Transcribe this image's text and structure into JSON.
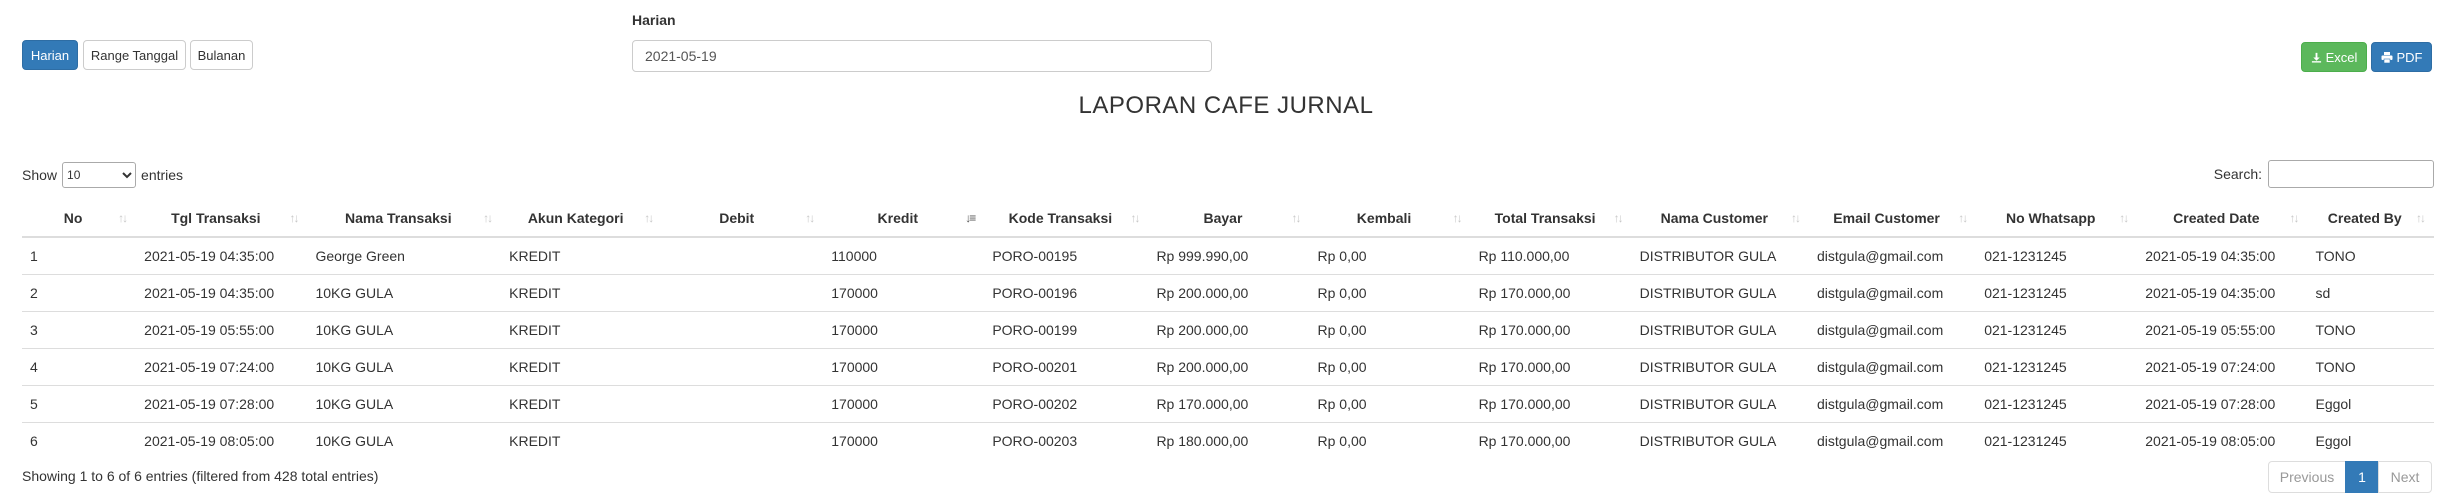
{
  "toolbar": {
    "harian_label": "Harian",
    "range_label": "Range Tanggal",
    "bulanan_label": "Bulanan",
    "excel_label": "Excel",
    "pdf_label": "PDF",
    "accent_color": "#337ab7",
    "excel_color": "#5cb85c"
  },
  "filter": {
    "label": "Harian",
    "date_value": "2021-05-19"
  },
  "report": {
    "title": "LAPORAN CAFE JURNAL"
  },
  "length": {
    "show_label": "Show",
    "selected": "10",
    "entries_label": "entries"
  },
  "search": {
    "label": "Search:",
    "value": ""
  },
  "table": {
    "columns": [
      "No",
      "Tgl Transaksi",
      "Nama Transaksi",
      "Akun Kategori",
      "Debit",
      "Kredit",
      "Kode Transaksi",
      "Bayar",
      "Kembali",
      "Total Transaksi",
      "Nama Customer",
      "Email Customer",
      "No Whatsapp",
      "Created Date",
      "Created By"
    ],
    "sorted_column": "Kredit",
    "rows": [
      [
        "1",
        "2021-05-19 04:35:00",
        "George Green",
        "KREDIT",
        "",
        "110000",
        "PORO-00195",
        "Rp 999.990,00",
        "Rp 0,00",
        "Rp 110.000,00",
        "DISTRIBUTOR GULA",
        "distgula@gmail.com",
        "021-1231245",
        "2021-05-19 04:35:00",
        "TONO"
      ],
      [
        "2",
        "2021-05-19 04:35:00",
        "10KG GULA",
        "KREDIT",
        "",
        "170000",
        "PORO-00196",
        "Rp 200.000,00",
        "Rp 0,00",
        "Rp 170.000,00",
        "DISTRIBUTOR GULA",
        "distgula@gmail.com",
        "021-1231245",
        "2021-05-19 04:35:00",
        "sd"
      ],
      [
        "3",
        "2021-05-19 05:55:00",
        "10KG GULA",
        "KREDIT",
        "",
        "170000",
        "PORO-00199",
        "Rp 200.000,00",
        "Rp 0,00",
        "Rp 170.000,00",
        "DISTRIBUTOR GULA",
        "distgula@gmail.com",
        "021-1231245",
        "2021-05-19 05:55:00",
        "TONO"
      ],
      [
        "4",
        "2021-05-19 07:24:00",
        "10KG GULA",
        "KREDIT",
        "",
        "170000",
        "PORO-00201",
        "Rp 200.000,00",
        "Rp 0,00",
        "Rp 170.000,00",
        "DISTRIBUTOR GULA",
        "distgula@gmail.com",
        "021-1231245",
        "2021-05-19 07:24:00",
        "TONO"
      ],
      [
        "5",
        "2021-05-19 07:28:00",
        "10KG GULA",
        "KREDIT",
        "",
        "170000",
        "PORO-00202",
        "Rp 170.000,00",
        "Rp 0,00",
        "Rp 170.000,00",
        "DISTRIBUTOR GULA",
        "distgula@gmail.com",
        "021-1231245",
        "2021-05-19 07:28:00",
        "Eggol"
      ],
      [
        "6",
        "2021-05-19 08:05:00",
        "10KG GULA",
        "KREDIT",
        "",
        "170000",
        "PORO-00203",
        "Rp 180.000,00",
        "Rp 0,00",
        "Rp 170.000,00",
        "DISTRIBUTOR GULA",
        "distgula@gmail.com",
        "021-1231245",
        "2021-05-19 08:05:00",
        "Eggol"
      ]
    ]
  },
  "footer": {
    "info": "Showing 1 to 6 of 6 entries (filtered from 428 total entries)",
    "previous_label": "Previous",
    "current_page": "1",
    "next_label": "Next"
  }
}
